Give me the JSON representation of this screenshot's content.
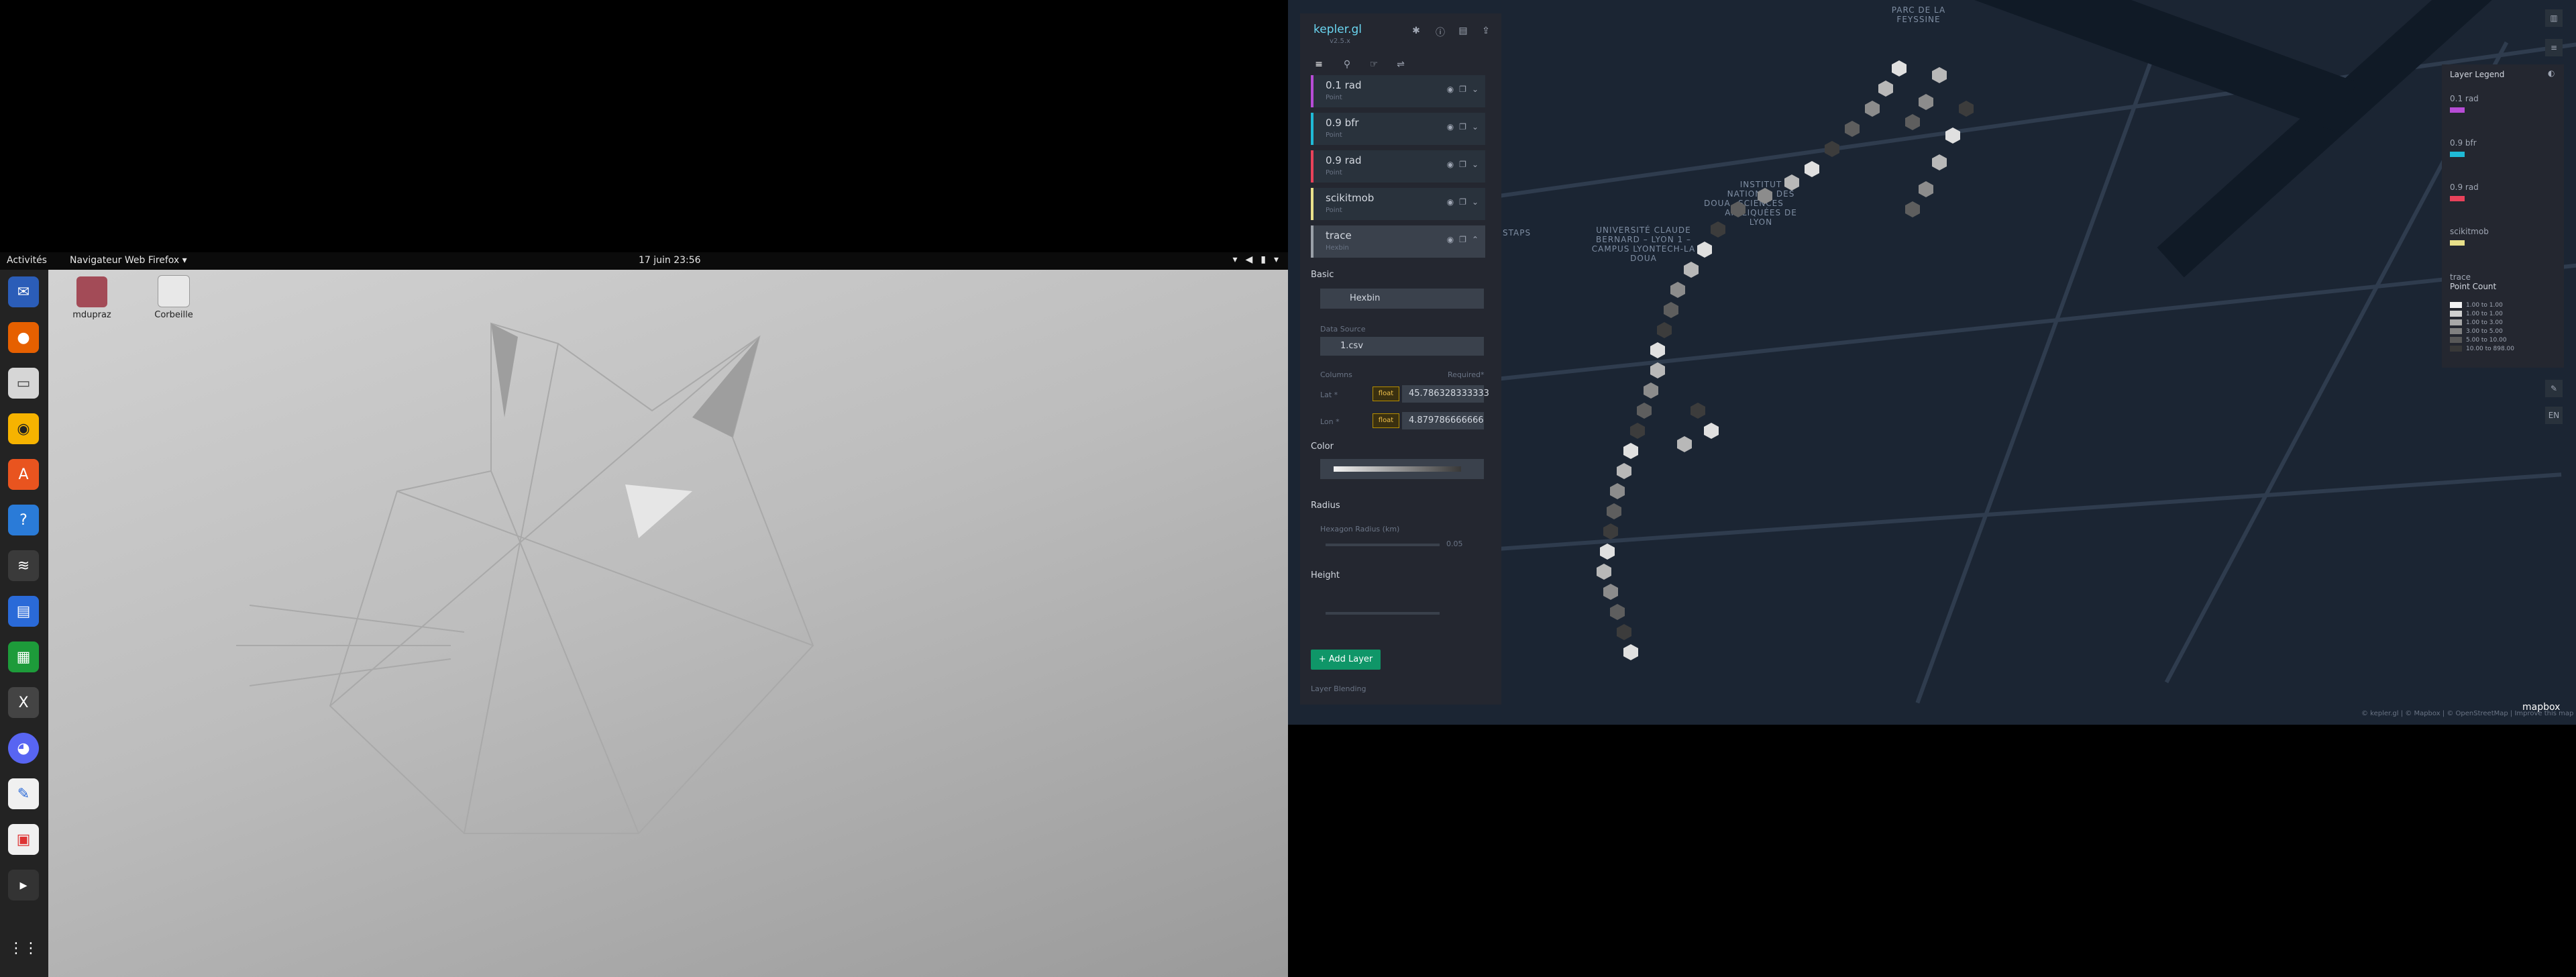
{
  "topbar": {
    "activities": "Activités",
    "firefox_label": "Navigateur Web Firefox ▾",
    "clock": "17 juin  23:56"
  },
  "desktop": {
    "icons": [
      {
        "label": "mdupraz"
      },
      {
        "label": "Corbeille"
      }
    ]
  },
  "dock": {
    "apps": [
      "thunderbird-icon",
      "firefox-icon",
      "files-icon",
      "rhythmbox-icon",
      "software-center-icon",
      "help-icon",
      "terminal-app-icon",
      "writer-icon",
      "calc-icon",
      "x-icon",
      "discord-icon",
      "text-editor-icon",
      "calculator-icon",
      "terminal-icon",
      "show-apps-icon"
    ]
  },
  "kepler": {
    "title": "kepler.gl",
    "version": "v2.5.x",
    "layers": [
      {
        "name": "0.1 rad",
        "type": "Point",
        "color": "#b74cd6"
      },
      {
        "name": "0.9 bfr",
        "type": "Point",
        "color": "#1fbad6"
      },
      {
        "name": "0.9 rad",
        "type": "Point",
        "color": "#e8425a"
      },
      {
        "name": "scikitmob",
        "type": "Point",
        "color": "#e8e08a"
      },
      {
        "name": "trace",
        "type": "Hexbin",
        "color": "#9aa0a8"
      }
    ],
    "basic_section": "Basic",
    "layer_type_value": "Hexbin",
    "data_source_label": "Data Source",
    "data_source_value": "1.csv",
    "columns_label": "Columns",
    "required_label": "Required*",
    "lat_label": "Lat *",
    "lat_type": "float",
    "lat_value": "45.786328333333",
    "lon_label": "Lon *",
    "lon_type": "float",
    "lon_value": "4.879786666666",
    "color_section": "Color",
    "radius_section": "Radius",
    "radius_label": "Hexagon Radius (km)",
    "radius_value": "0.05",
    "height_section": "Height",
    "add_layer_label": "+ Add Layer",
    "layer_blending_label": "Layer Blending"
  },
  "map": {
    "labels": [
      "PARC DE LA FEYSSINE",
      "UNIVERSITÉ CLAUDE BERNARD – LYON 1 – CAMPUS LYONTECH-LA DOUA",
      "INSTITUT NATIONAL DES SCIENCES APPLIQUÉES DE LYON",
      "STAPS",
      "DOUA"
    ],
    "attribution": "© kepler.gl | © Mapbox | © OpenStreetMap | Improve this map",
    "mapbox_logo": "mapbox"
  },
  "legend": {
    "title": "Layer Legend",
    "items": [
      {
        "name": "0.1 rad",
        "color": "#b74cd6"
      },
      {
        "name": "0.9 bfr",
        "color": "#1fbad6"
      },
      {
        "name": "0.9 rad",
        "color": "#e8425a"
      },
      {
        "name": "scikitmob",
        "color": "#e8e08a"
      }
    ],
    "trace_name": "trace",
    "trace_sub": "Point Count",
    "ranges": [
      "1.00 to 1.00",
      "1.00 to 1.00",
      "1.00 to 3.00",
      "3.00 to 5.00",
      "5.00 to 10.00",
      "10.00 to 898.00"
    ],
    "range_colors": [
      "#f2f2f2",
      "#d0d0d0",
      "#a8a8a8",
      "#808080",
      "#585858",
      "#383838"
    ]
  }
}
